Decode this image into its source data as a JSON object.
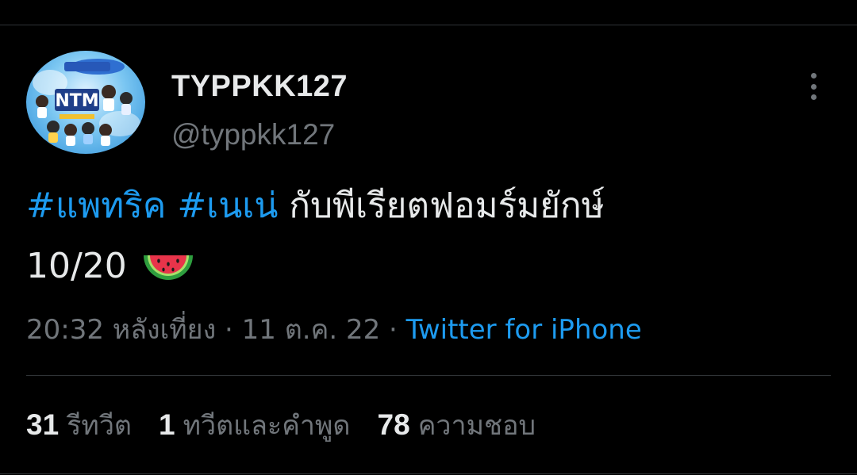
{
  "tweet": {
    "author": {
      "display_name": "TYPPKK127",
      "handle": "@typpkk127",
      "avatar_logo_text": "NTM"
    },
    "text": {
      "hashtags": [
        "#แพทริค",
        "#เนเน่"
      ],
      "body": "กับพีเรียตฟอมร์มยักษ์",
      "line2": "10/20",
      "emoji": "watermelon"
    },
    "meta": {
      "time": "20:32 หลังเที่ยง",
      "separator": "·",
      "date": "11 ต.ค. 22",
      "source": "Twitter for iPhone"
    },
    "stats": [
      {
        "count": "31",
        "label": "รีทวีต"
      },
      {
        "count": "1",
        "label": "ทวีตและคำพูด"
      },
      {
        "count": "78",
        "label": "ความชอบ"
      }
    ],
    "more_icon": "more-vertical-icon"
  },
  "colors": {
    "background": "#000000",
    "text": "#e7e9ea",
    "secondary": "#71767b",
    "link": "#1d9bf0",
    "divider": "#2f3336"
  }
}
